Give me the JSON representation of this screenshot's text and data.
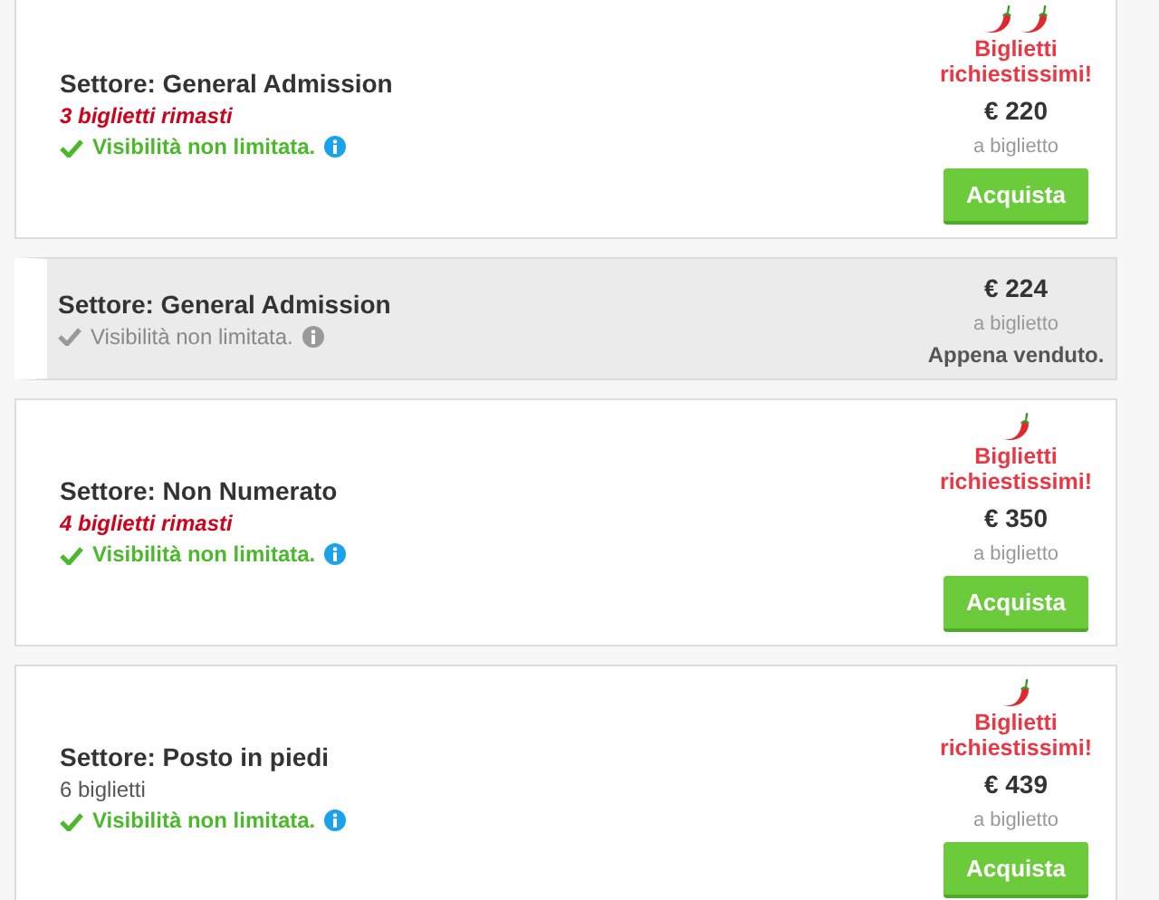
{
  "listings": [
    {
      "sector": "Settore: General Admission",
      "sold": false,
      "remaining": {
        "text": "3 biglietti rimasti",
        "kind": "urgent"
      },
      "visibility": "Visibilità non limitata.",
      "demand": {
        "icons": [
          {
            "kind": "chili"
          },
          {
            "kind": "chili"
          }
        ],
        "label": "Biglietti richiestissimi!"
      },
      "price": "€ 220",
      "unit": "a biglietto",
      "button": "Acquista"
    },
    {
      "sector": "Settore: General Admission",
      "sold": true,
      "visibility": "Visibilità non limitata.",
      "price": "€ 224",
      "unit": "a biglietto",
      "status": "Appena venduto."
    },
    {
      "sector": "Settore: Non Numerato",
      "sold": false,
      "remaining": {
        "text": "4 biglietti rimasti",
        "kind": "urgent"
      },
      "visibility": "Visibilità non limitata.",
      "demand": {
        "icons": [
          {
            "kind": "chili"
          }
        ],
        "label": "Biglietti richiestissimi!"
      },
      "price": "€ 350",
      "unit": "a biglietto",
      "button": "Acquista"
    },
    {
      "sector": "Settore: Posto in piedi",
      "sold": false,
      "remaining": {
        "text": "6 biglietti",
        "kind": "plain"
      },
      "visibility": "Visibilità non limitata.",
      "demand": {
        "icons": [
          {
            "kind": "chili"
          }
        ],
        "label": "Biglietti richiestissimi!"
      },
      "price": "€ 439",
      "unit": "a biglietto",
      "button": "Acquista"
    }
  ]
}
